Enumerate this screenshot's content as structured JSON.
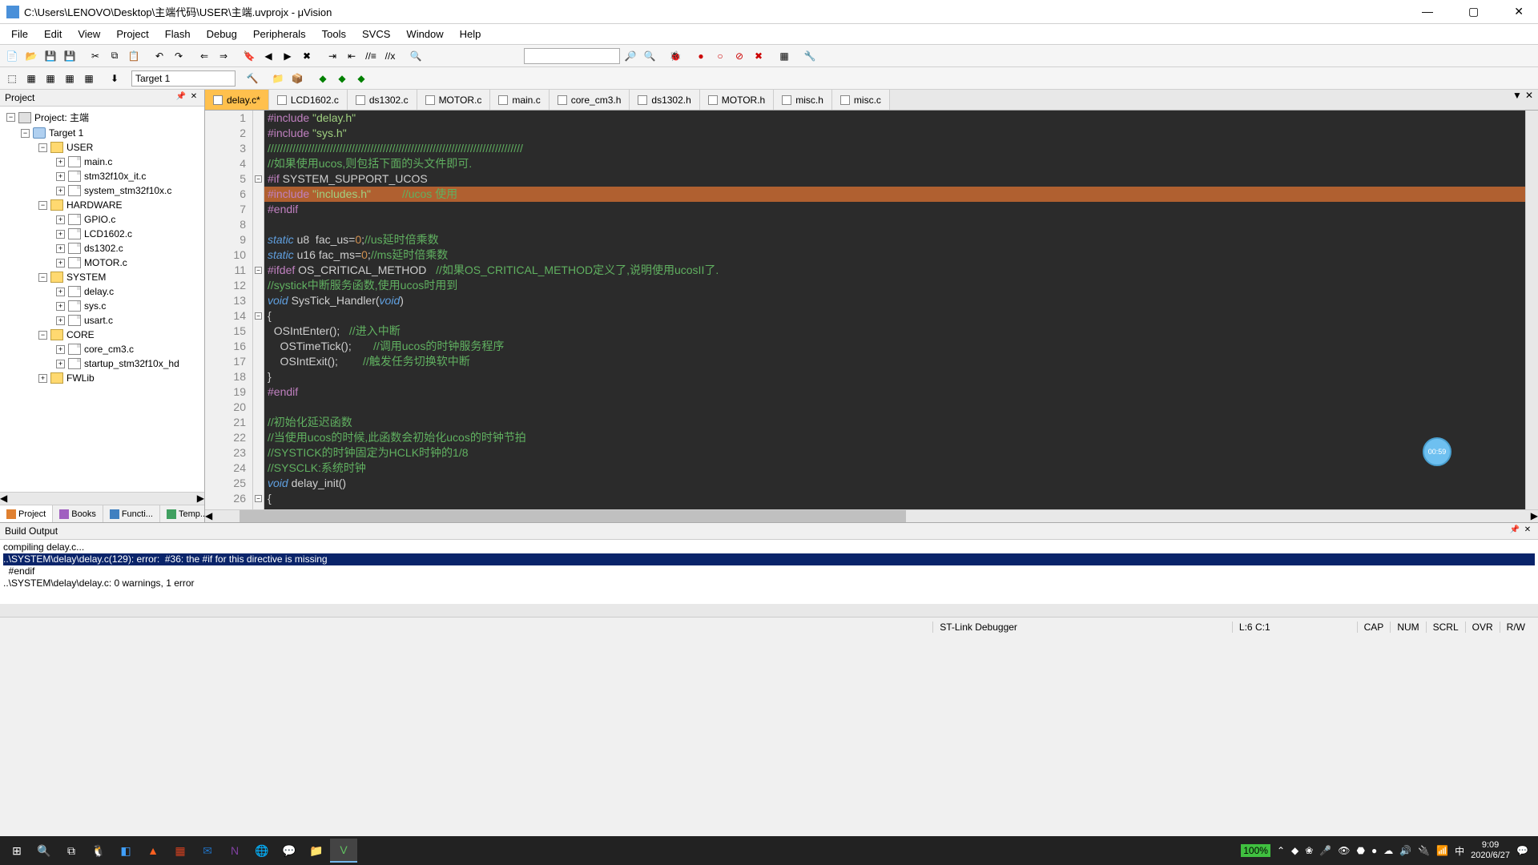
{
  "title": "C:\\Users\\LENOVO\\Desktop\\主端代码\\USER\\主端.uvprojx - μVision",
  "menu": [
    "File",
    "Edit",
    "View",
    "Project",
    "Flash",
    "Debug",
    "Peripherals",
    "Tools",
    "SVCS",
    "Window",
    "Help"
  ],
  "target_combo": "Target 1",
  "project_panel_title": "Project",
  "tree": {
    "root": "Project: 主端",
    "target": "Target 1",
    "groups": [
      {
        "name": "USER",
        "files": [
          "main.c",
          "stm32f10x_it.c",
          "system_stm32f10x.c"
        ]
      },
      {
        "name": "HARDWARE",
        "files": [
          "GPIO.c",
          "LCD1602.c",
          "ds1302.c",
          "MOTOR.c"
        ]
      },
      {
        "name": "SYSTEM",
        "files": [
          "delay.c",
          "sys.c",
          "usart.c"
        ]
      },
      {
        "name": "CORE",
        "files": [
          "core_cm3.c",
          "startup_stm32f10x_hd"
        ]
      },
      {
        "name": "FWLib",
        "files": []
      }
    ]
  },
  "project_tabs": [
    "Project",
    "Books",
    "Functi...",
    "Temp..."
  ],
  "file_tabs": [
    {
      "label": "delay.c*",
      "active": true
    },
    {
      "label": "LCD1602.c"
    },
    {
      "label": "ds1302.c"
    },
    {
      "label": "MOTOR.c"
    },
    {
      "label": "main.c"
    },
    {
      "label": "core_cm3.h"
    },
    {
      "label": "ds1302.h"
    },
    {
      "label": "MOTOR.h"
    },
    {
      "label": "misc.h"
    },
    {
      "label": "misc.c"
    }
  ],
  "code": [
    {
      "n": 1,
      "html": "<span class='kw-pp'>#include</span> <span class='kw-str'>\"delay.h\"</span>"
    },
    {
      "n": 2,
      "html": "<span class='kw-pp'>#include</span> <span class='kw-str'>\"sys.h\"</span>"
    },
    {
      "n": 3,
      "html": "<span class='kw-cmt'>//////////////////////////////////////////////////////////////////////////////////</span>"
    },
    {
      "n": 4,
      "html": "<span class='kw-cmt'>//如果使用ucos,则包括下面的头文件即可.</span>"
    },
    {
      "n": 5,
      "fold": true,
      "html": "<span class='kw-pp'>#if</span> SYSTEM_SUPPORT_UCOS"
    },
    {
      "n": 6,
      "hl": true,
      "html": "<span class='kw-pp'>#include</span> <span class='kw-str'>\"includes.h\"</span>          <span class='kw-cmt'>//ucos 使用</span>   "
    },
    {
      "n": 7,
      "html": "<span class='kw-pp'>#endif</span>"
    },
    {
      "n": 8,
      "html": ""
    },
    {
      "n": 9,
      "html": "<span class='kw-type'>static</span> u8  fac_us=<span class='kw-num'>0</span>;<span class='kw-cmt'>//us延时倍乘数</span>"
    },
    {
      "n": 10,
      "html": "<span class='kw-type'>static</span> u16 fac_ms=<span class='kw-num'>0</span>;<span class='kw-cmt'>//ms延时倍乘数</span>"
    },
    {
      "n": 11,
      "fold": true,
      "html": "<span class='kw-pp'>#ifdef</span> OS_CRITICAL_METHOD   <span class='kw-cmt'>//如果OS_CRITICAL_METHOD定义了,说明使用ucosII了.</span>"
    },
    {
      "n": 12,
      "html": "<span class='kw-cmt'>//systick中断服务函数,使用ucos时用到</span>"
    },
    {
      "n": 13,
      "html": "<span class='kw-type'>void</span> SysTick_Handler(<span class='kw-type'>void</span>)"
    },
    {
      "n": 14,
      "fold": true,
      "html": "{"
    },
    {
      "n": 15,
      "html": "  OSIntEnter();   <span class='kw-cmt'>//进入中断</span>"
    },
    {
      "n": 16,
      "html": "    OSTimeTick();       <span class='kw-cmt'>//调用ucos的时钟服务程序</span>"
    },
    {
      "n": 17,
      "html": "    OSIntExit();        <span class='kw-cmt'>//触发任务切换软中断</span>"
    },
    {
      "n": 18,
      "html": "}"
    },
    {
      "n": 19,
      "html": "<span class='kw-pp'>#endif</span>"
    },
    {
      "n": 20,
      "html": ""
    },
    {
      "n": 21,
      "html": "<span class='kw-cmt'>//初始化延迟函数</span>"
    },
    {
      "n": 22,
      "html": "<span class='kw-cmt'>//当使用ucos的时候,此函数会初始化ucos的时钟节拍</span>"
    },
    {
      "n": 23,
      "html": "<span class='kw-cmt'>//SYSTICK的时钟固定为HCLK时钟的1/8</span>"
    },
    {
      "n": 24,
      "html": "<span class='kw-cmt'>//SYSCLK:系统时钟</span>"
    },
    {
      "n": 25,
      "html": "<span class='kw-type'>void</span> delay_init()"
    },
    {
      "n": 26,
      "fold": true,
      "html": "{"
    }
  ],
  "build_title": "Build Output",
  "build_lines": [
    {
      "text": "compiling delay.c..."
    },
    {
      "text": "..\\SYSTEM\\delay\\delay.c(129): error:  #36: the #if for this directive is missing",
      "err": true
    },
    {
      "text": "  #endif"
    },
    {
      "text": "..\\SYSTEM\\delay\\delay.c: 0 warnings, 1 error"
    }
  ],
  "status": {
    "debugger": "ST-Link Debugger",
    "cursor": "L:6 C:1",
    "caps": "CAP",
    "num": "NUM",
    "scrl": "SCRL",
    "ovr": "OVR",
    "rw": "R/W"
  },
  "tray": {
    "battery": "100%",
    "ime": "中",
    "time": "9:09",
    "date": "2020/6/27"
  },
  "badge": "00:59"
}
